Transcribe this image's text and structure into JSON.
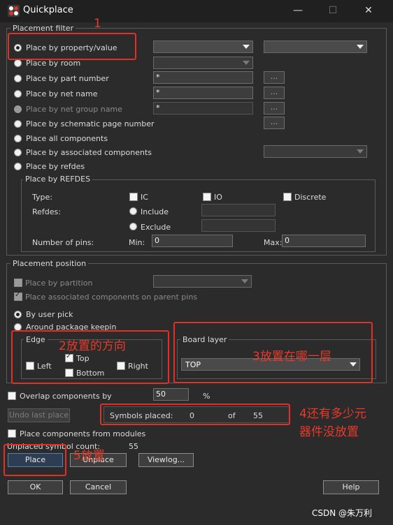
{
  "window": {
    "title": "Quickplace",
    "minimize": "—",
    "maximize": "☐",
    "close": "✕"
  },
  "placement_filter": {
    "legend": "Placement filter",
    "options": [
      "Place by property/value",
      "Place by room",
      "Place by part number",
      "Place by net name",
      "Place by net group name",
      "Place by schematic page number",
      "Place all components",
      "Place by associated components",
      "Place by refdes"
    ],
    "part_number_value": "*",
    "net_name_value": "*",
    "net_group_value": "*",
    "dots": "...",
    "refdes_group": {
      "legend": "Place by REFDES",
      "type_label": "Type:",
      "ic": "IC",
      "io": "IO",
      "discrete": "Discrete",
      "refdes_label": "Refdes:",
      "include": "Include",
      "exclude": "Exclude",
      "pins_label": "Number of pins:",
      "min_label": "Min:",
      "min_value": "0",
      "max_label": "Max:",
      "max_value": "0"
    }
  },
  "placement_position": {
    "legend": "Placement position",
    "by_partition": "Place by partition",
    "assoc_parent_pins": "Place associated components on parent pins",
    "by_user_pick": "By user pick",
    "around_keepin": "Around package keepin",
    "edge": {
      "legend": "Edge",
      "left": "Left",
      "top": "Top",
      "right": "Right",
      "bottom": "Bottom"
    },
    "board_layer": {
      "legend": "Board layer",
      "value": "TOP"
    }
  },
  "overlap": {
    "label": "Overlap components by",
    "value": "50",
    "unit": "%"
  },
  "undo_label": "Undo last place",
  "symbols": {
    "label": "Symbols placed:",
    "placed": "0",
    "of": "of",
    "total": "55"
  },
  "modules_label": "Place components from modules",
  "unplaced": {
    "label": "Unplaced symbol count:",
    "value": "55"
  },
  "buttons": {
    "place": "Place",
    "unplace": "Unplace",
    "viewlog": "Viewlog...",
    "ok": "OK",
    "cancel": "Cancel",
    "help": "Help"
  },
  "annotations": {
    "a1": "1",
    "a2": "2放置的方向",
    "a3": "3放置在哪一层",
    "a4_line1": "4还有多少元",
    "a4_line2": "器件没放置",
    "a5": "5放置"
  },
  "watermark": "CSDN @朱万利",
  "colors": {
    "accent_red": "#e03028",
    "background": "#2b2b2b"
  }
}
